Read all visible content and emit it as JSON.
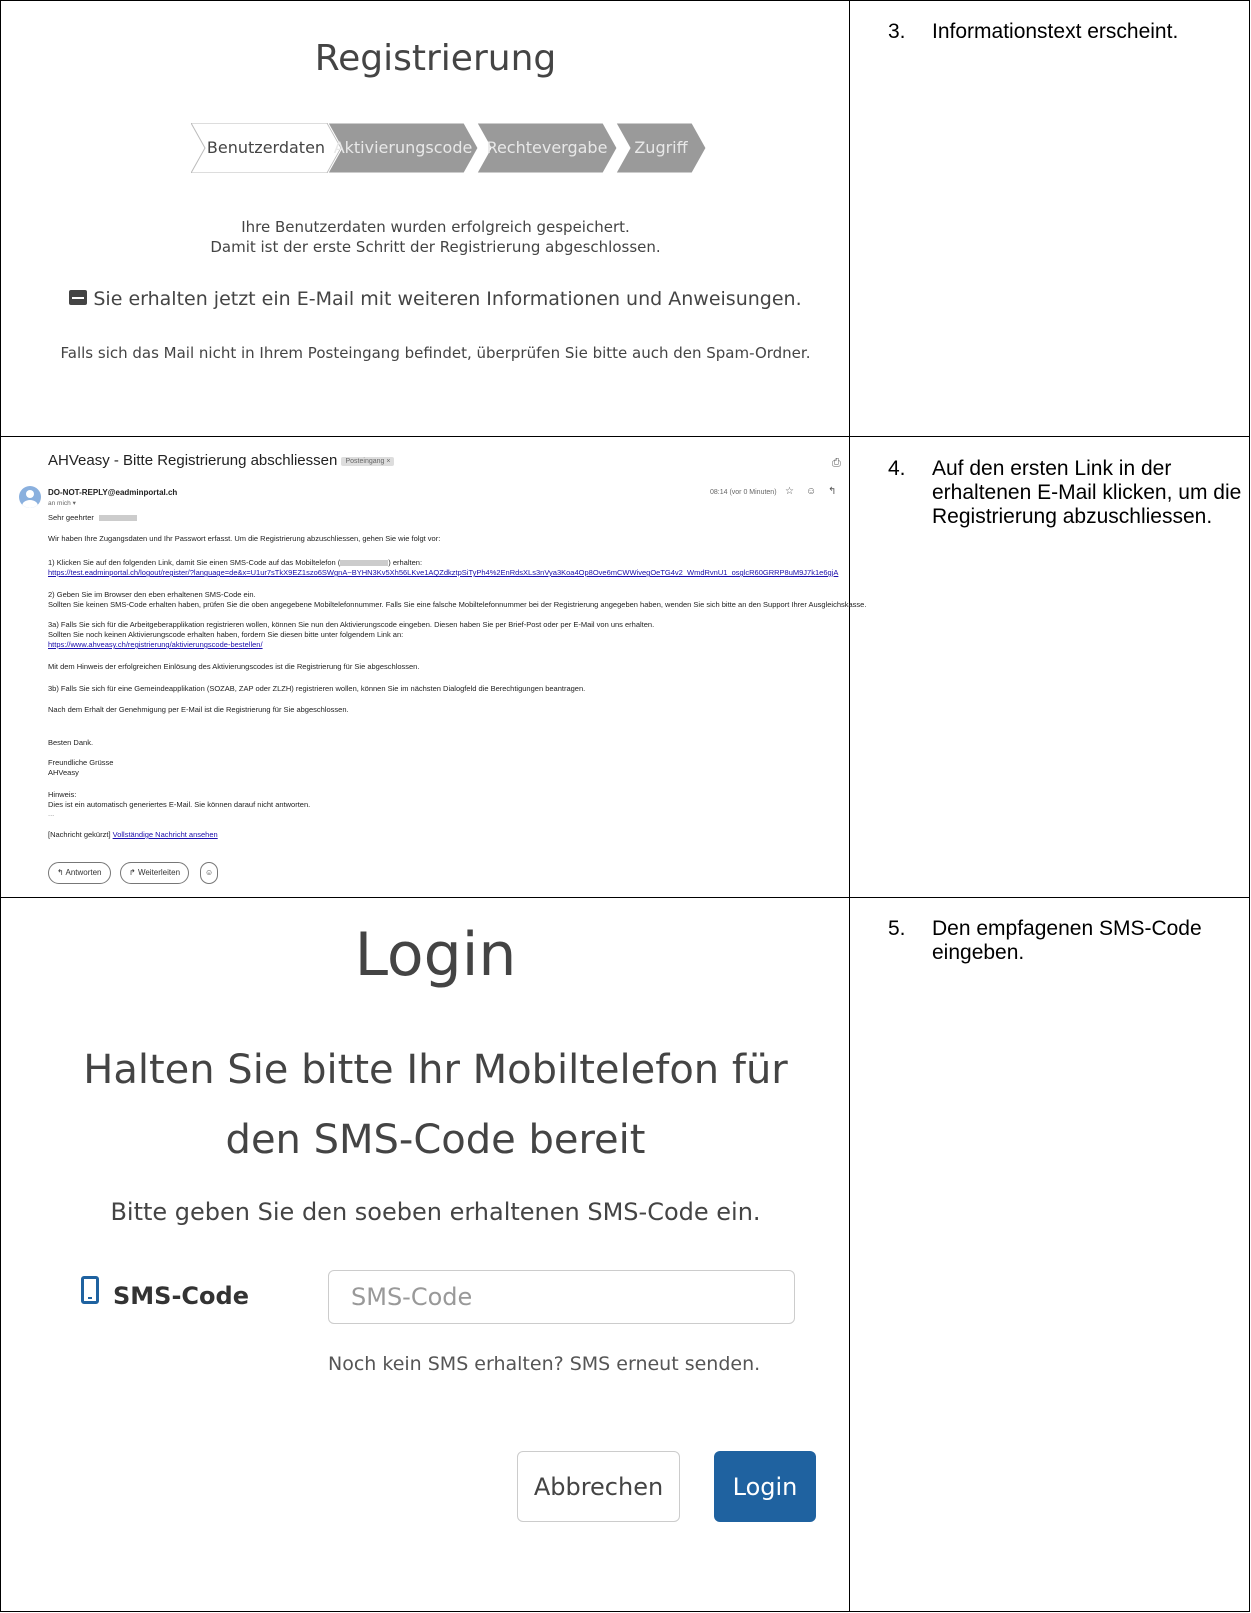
{
  "steps": [
    {
      "num": "3.",
      "text": "Informationstext erscheint."
    },
    {
      "num": "4.",
      "text": "Auf den ersten Link in der erhaltenen E-Mail klicken, um die Registrierung abzuschliessen."
    },
    {
      "num": "5.",
      "text": "Den empfagenen SMS-Code eingeben."
    }
  ],
  "registration": {
    "title": "Registrierung",
    "wizard": [
      "Benutzerdaten",
      "Aktivierungscode",
      "Rechtevergabe",
      "Zugriff"
    ],
    "line1": "Ihre Benutzerdaten wurden erfolgreich gespeichert.",
    "line2": "Damit ist der erste Schritt der Registrierung abgeschlossen.",
    "mail_line": "Sie erhalten jetzt ein E-Mail mit weiteren Informationen und Anweisungen.",
    "spam_line": "Falls sich das Mail nicht in Ihrem Posteingang befindet, überprüfen Sie bitte auch den Spam-Ordner."
  },
  "email": {
    "subject": "AHVeasy - Bitte Registrierung abschliessen",
    "label": "Posteingang ×",
    "sender": "DO-NOT-REPLY@eadminportal.ch",
    "to": "an mich ▾",
    "time": "08:14 (vor 0 Minuten)",
    "greeting": "Sehr geehrter",
    "intro": "Wir haben Ihre Zugangsdaten und Ihr Passwort erfasst. Um die Registrierung abzuschliessen, gehen Sie wie folgt vor:",
    "p1": "1) Klicken Sie auf den folgenden Link, damit Sie einen SMS-Code auf das Mobiltelefon (",
    "p1b": ") erhalten:",
    "link1": "https://test.eadminportal.ch/logout/register/?language=de&x=U1ur7sTkX9EZ1szo6SWgnA~BYHN3Kv5Xh56LKve1AQZdkztpSiTyPh4%2EnRdsXLs3nVya3Koa4Op8Ove6mCWWivegOeTG4v2_WmdRvnU1_osglcR60GRRP8uM9J7k1e6gjA",
    "p2a": "2) Geben Sie im Browser den eben erhaltenen SMS-Code ein.",
    "p2b": "Sollten Sie keinen SMS-Code erhalten haben, prüfen Sie die oben angegebene Mobiltelefonnummer. Falls Sie eine falsche Mobiltelefonnummer bei der Registrierung angegeben haben, wenden Sie sich bitte an den Support Ihrer Ausgleichskasse.",
    "p3a": "3a) Falls Sie sich für die Arbeitgeberapplikation registrieren wollen, können Sie nun den Aktivierungscode eingeben. Diesen haben Sie per Brief-Post oder per E-Mail von uns erhalten.",
    "p3b": "Sollten Sie noch keinen Aktivierungscode erhalten haben, fordern Sie diesen bitte unter folgendem Link an:",
    "link2": "https://www.ahveasy.ch/registrierung/aktivierungscode-bestellen/",
    "p4": "Mit dem Hinweis der erfolgreichen Einlösung des Aktivierungscodes ist die Registrierung für Sie abgeschlossen.",
    "p5": "3b) Falls Sie sich für eine Gemeindeapplikation (SOZAB, ZAP oder ZLZH) registrieren wollen, können Sie im nächsten Dialogfeld die Berechtigungen beantragen.",
    "p6": "Nach dem Erhalt der Genehmigung per E-Mail ist die Registrierung für Sie abgeschlossen.",
    "thanks": "Besten Dank.",
    "regards": "Freundliche Grüsse",
    "org": "AHVeasy",
    "note_title": "Hinweis:",
    "note": "Dies ist ein automatisch generiertes E-Mail. Sie können darauf nicht antworten.",
    "dots": "...",
    "truncated": "[Nachricht gekürzt]",
    "full_link": "Vollständige Nachricht ansehen",
    "reply": "Antworten",
    "forward": "Weiterleiten"
  },
  "login": {
    "title": "Login",
    "heading1": "Halten Sie bitte Ihr Mobiltelefon für",
    "heading2": "den SMS-Code bereit",
    "instruction": "Bitte geben Sie den soeben erhaltenen SMS-Code ein.",
    "field_label": "SMS-Code",
    "placeholder": "SMS-Code",
    "resend": "Noch kein SMS erhalten? SMS erneut senden.",
    "cancel": "Abbrechen",
    "login": "Login"
  },
  "colors": {
    "primary": "#1f62a0",
    "wizard_active": "#ffffff",
    "wizard_inactive": "#9a9a9a",
    "link": "#1a0dab"
  }
}
